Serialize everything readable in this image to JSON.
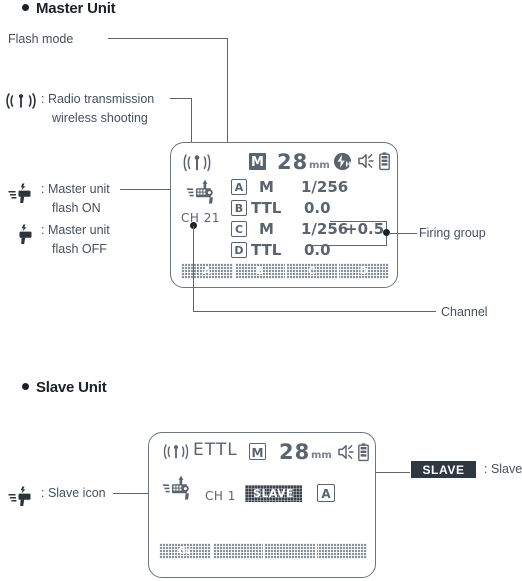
{
  "sections": {
    "master": {
      "heading": "Master Unit",
      "callouts": {
        "flash_mode": "Flash mode",
        "radio_line1": ": Radio transmission",
        "radio_line2": "wireless shooting",
        "master_on_line1": ": Master unit",
        "master_on_line2": "flash ON",
        "master_off_line1": ": Master unit",
        "master_off_line2": "flash OFF",
        "firing_group": "Firing group",
        "channel": "Channel"
      },
      "lcd": {
        "radio_icon": "radio-transmission-icon",
        "flash_mode": "M",
        "zoom_value": "28",
        "zoom_unit": "mm",
        "hs_icon": "high-speed-sync-icon",
        "beep_icon": "beep-icon",
        "battery_icon": "battery-icon",
        "master_icon": "master-flash-on-icon",
        "channel": "CH 21",
        "groups": [
          {
            "id": "A",
            "mode": "M",
            "value": "1/256"
          },
          {
            "id": "B",
            "mode": "TTL",
            "value": "0.0"
          },
          {
            "id": "C",
            "mode": "M",
            "value": "1/256",
            "comp": "+0.5"
          },
          {
            "id": "D",
            "mode": "TTL",
            "value": "0.0"
          }
        ],
        "bar_cells": [
          "A",
          "B",
          "C",
          "D"
        ]
      }
    },
    "slave": {
      "heading": "Slave Unit",
      "callouts": {
        "slave_icon_label": ": Slave icon",
        "slave_badge_legend": ": Slave"
      },
      "legend_chip": "SLAVE",
      "lcd": {
        "radio_icon": "radio-transmission-icon",
        "mode": "ETTL",
        "flash_mode": "M",
        "zoom_value": "28",
        "zoom_unit": "mm",
        "beep_icon": "beep-icon",
        "battery_icon": "battery-icon",
        "slave_icon": "slave-icon",
        "channel": "CH 1",
        "slave_chip": "SLAVE",
        "group": "A",
        "bar_cells": [
          "Gr",
          "",
          "",
          ""
        ]
      }
    }
  },
  "colors": {
    "ink": "#3c4752",
    "heading": "#1b2128",
    "lcd_border": "#6b7680",
    "lcd_text": "#5a646e",
    "bar": "#8a939c",
    "chip": "#2f3841"
  }
}
